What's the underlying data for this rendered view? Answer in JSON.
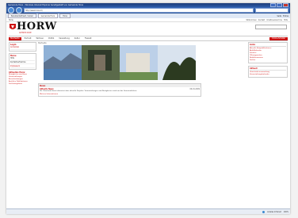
{
  "window": {
    "title": "Gemeinde Horw - Windows Internet Explorer bereitgestellt von Gemeinde Horw"
  },
  "browser": {
    "address": "http://www.horw.ch/",
    "tabs": [
      {
        "label": "Benutzerdefiniert / Gmail"
      },
      {
        "label": "Gemeinde Horw"
      },
      {
        "label": "Horw"
      }
    ],
    "tools": [
      "Seite",
      "Extras"
    ]
  },
  "site": {
    "topline_left": "Horw",
    "topline_links": [
      "Willkommen",
      "Kontakt",
      "Inhaltsverzeichnis",
      "Hilfe"
    ],
    "logo_word": "HORW",
    "logo_sub": "GEMEINDE",
    "menu": [
      {
        "label": "Startseite",
        "active": true
      },
      {
        "label": "Portrait"
      },
      {
        "label": "Wohnen"
      },
      {
        "label": "Politik"
      },
      {
        "label": "Verwaltung"
      },
      {
        "label": "Kultur"
      },
      {
        "label": "Freizeit"
      }
    ],
    "menu_button": "Online-Schalter"
  },
  "leftnav": {
    "sections": [
      {
        "head": "Login",
        "items": [
          "Anmelden"
        ]
      },
      {
        "head": "Menu",
        "items": [
          "Hilfe",
          "Kontaktaufnahme",
          "Impressum"
        ]
      }
    ],
    "aktuell_head": "Aktuelles Horw",
    "aktuell_items": [
      "Neuigkeiten aus Horw",
      "Veranstaltungen",
      "Ausschreibungen",
      "Amtliche Publikationen",
      "Stellenangebote"
    ]
  },
  "main": {
    "breadcrumb": "Startseite",
    "news": {
      "head": "News",
      "title": "Aktuelle News",
      "date": "06.01.2009",
      "text": "Die Gemeinde Horw informiert über aktuelle Projekte, Veranstaltungen und Neuigkeiten rund um das Gemeindeleben.",
      "more": "Weitere Informationen"
    }
  },
  "rightcol": {
    "boxes": [
      {
        "head": "Links",
        "items": [
          "Aktuelle Baupublikationen",
          "Abfallkalender",
          "Schulen",
          "Öffnungszeiten",
          "Notfallnummern",
          "Stellen"
        ]
      },
      {
        "head": "Aktuell",
        "items": [
          "Gemeindeversammlung",
          "Veranstaltungskalender"
        ]
      }
    ]
  },
  "statusbar": {
    "left": "",
    "zone": "Lokales Intranet",
    "zoom": "100%"
  }
}
